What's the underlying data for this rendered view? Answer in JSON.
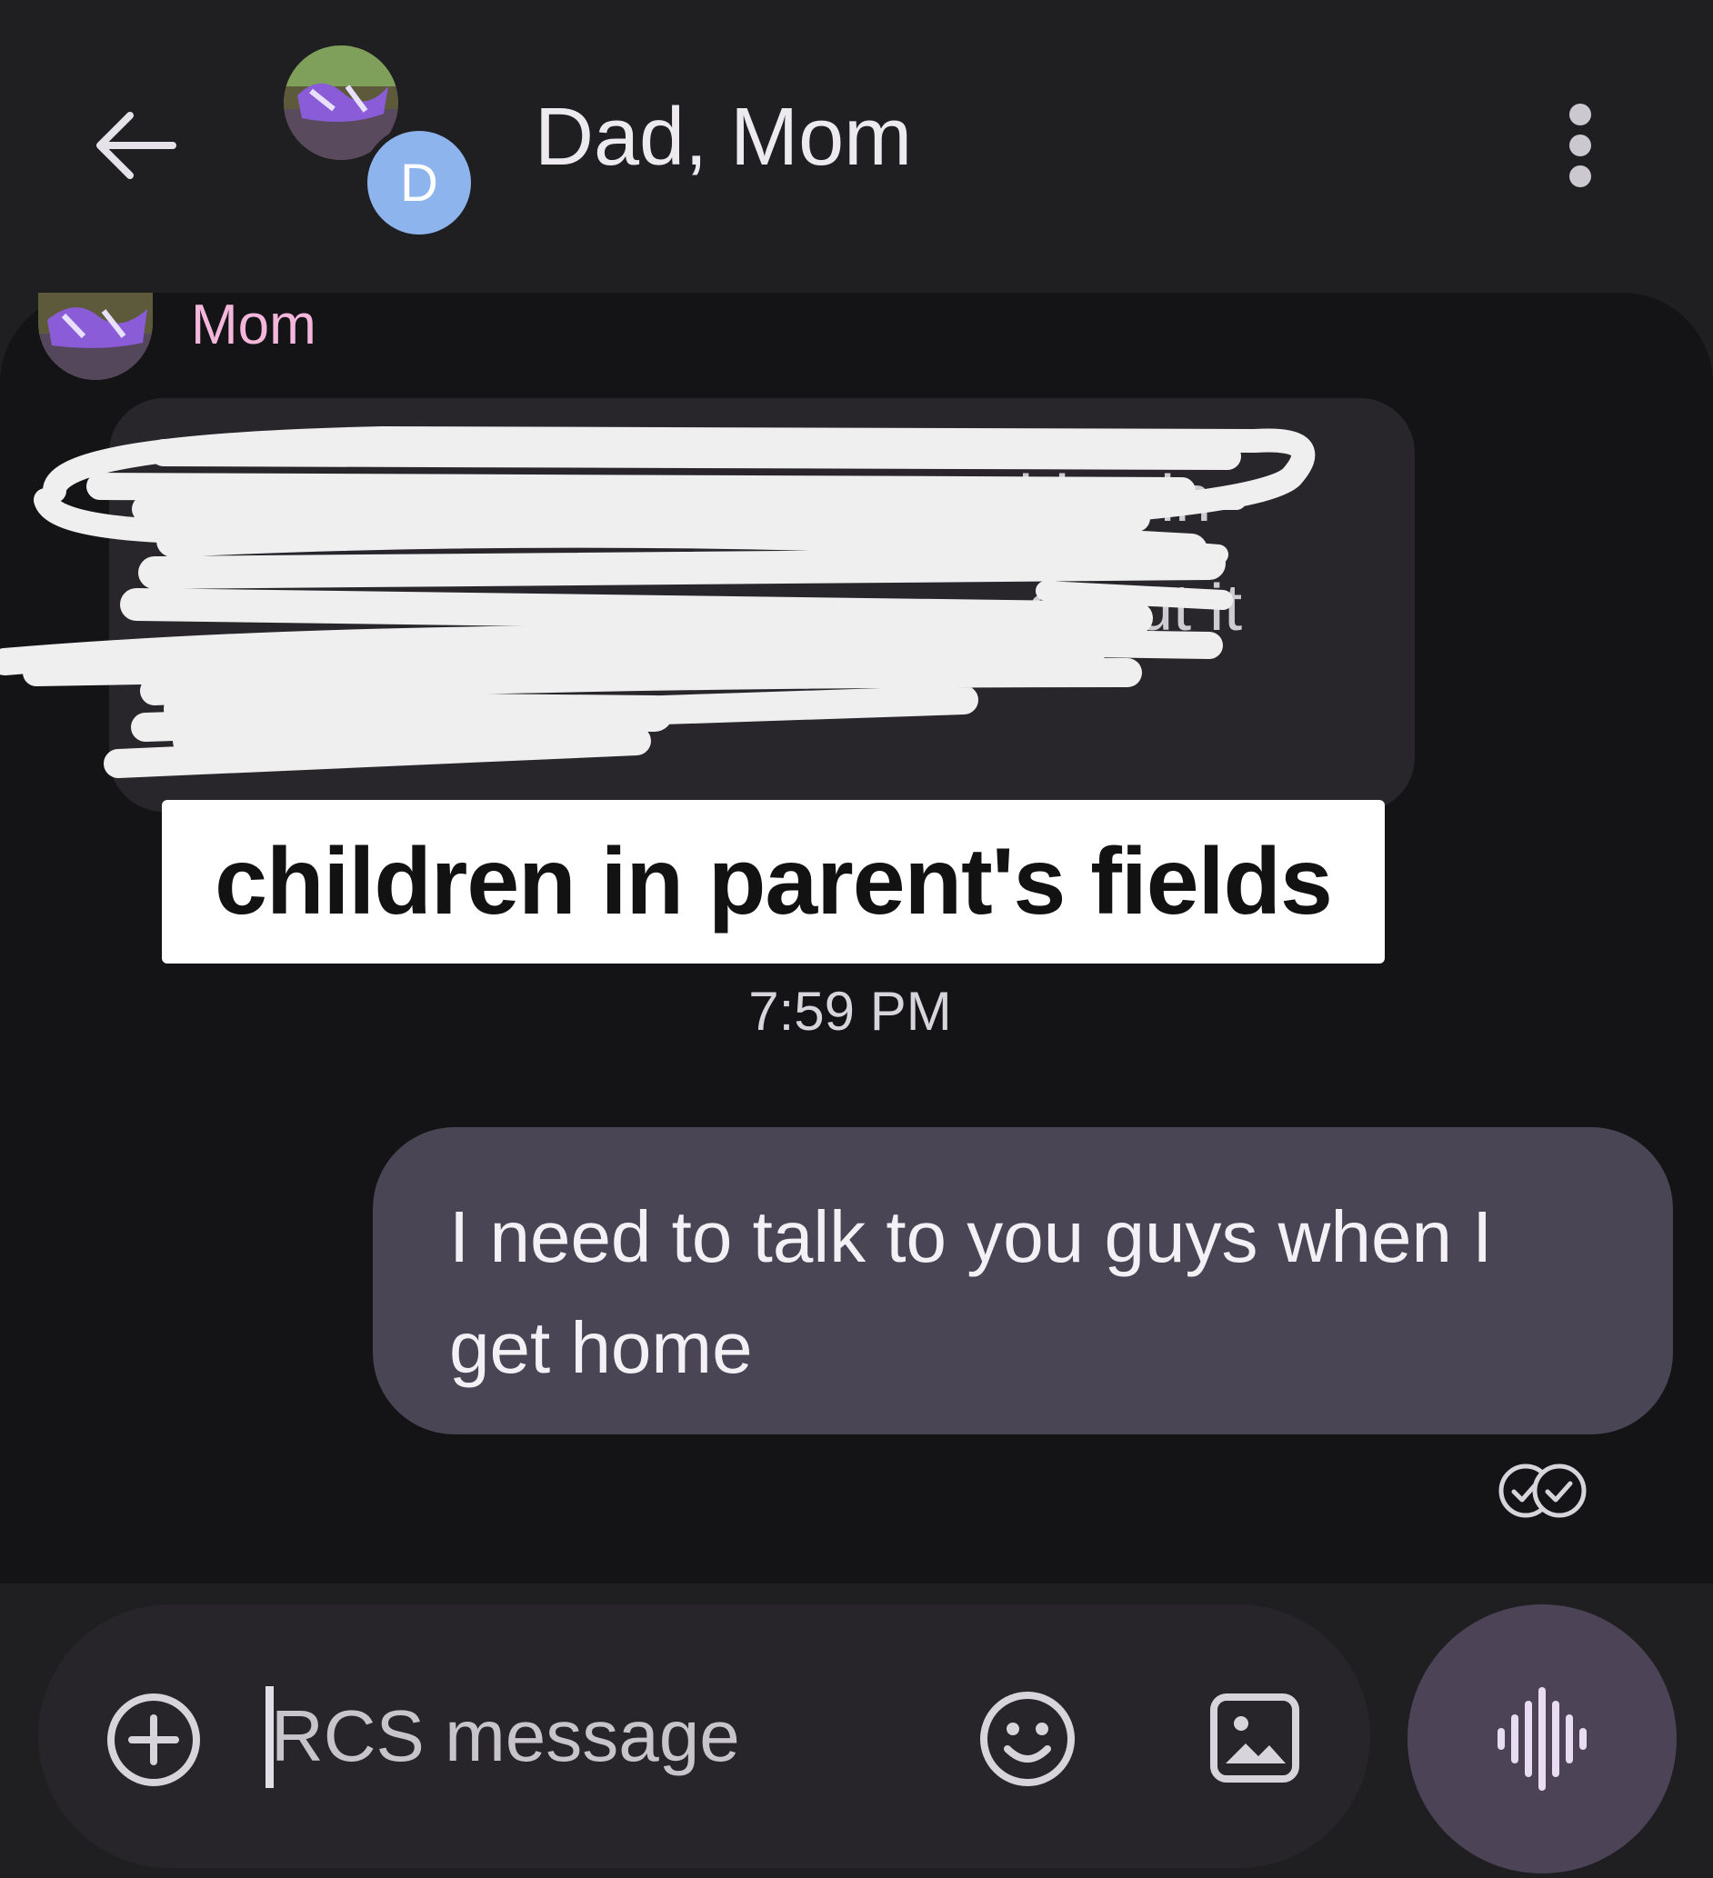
{
  "header": {
    "title": "Dad, Mom",
    "dad_avatar_letter": "D",
    "back_icon": "arrow-left-icon",
    "menu_icon": "more-vert-icon"
  },
  "thread": {
    "incoming": {
      "sender": "Mom",
      "visible_fragments": [
        "othing in",
        "about it"
      ],
      "caption": "children in parent's fields",
      "timestamp": "7:59 PM"
    },
    "outgoing": {
      "text": "I need to talk to you guys when I get home",
      "status_icon": "double-check-read-icon"
    }
  },
  "compose": {
    "placeholder": "RCS message",
    "add_icon": "add-circle-icon",
    "emoji_icon": "emoji-icon",
    "gallery_icon": "image-icon",
    "voice_icon": "voice-waveform-icon"
  },
  "colors": {
    "background": "#1f1e21",
    "thread_background": "#141316",
    "incoming_bubble": "#28262a",
    "outgoing_bubble": "#4a4554",
    "sender_name": "#f3b7dc",
    "dad_avatar": "#8eb4ee",
    "voice_button": "#4c4357"
  }
}
